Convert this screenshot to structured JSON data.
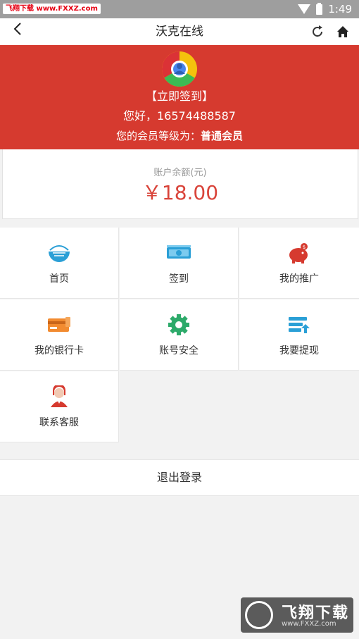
{
  "status_bar": {
    "watermark": "飞翔下载 www.FXXZ.com",
    "time": "1:49"
  },
  "nav": {
    "title": "沃克在线"
  },
  "profile": {
    "sign_in": "【立即签到】",
    "greeting": "您好，16574488587",
    "level_prefix": "您的会员等级为：",
    "level_value": "普通会员"
  },
  "balance": {
    "label": "账户余额(元)",
    "value": "￥18.00"
  },
  "menu": [
    {
      "label": "首页",
      "icon": "home-bowl-icon",
      "color": "#2a9fd6"
    },
    {
      "label": "签到",
      "icon": "cash-stack-icon",
      "color": "#2a9fd6"
    },
    {
      "label": "我的推广",
      "icon": "piggy-bank-icon",
      "color": "#d63a2f"
    },
    {
      "label": "我的银行卡",
      "icon": "bank-card-icon",
      "color": "#f28b30"
    },
    {
      "label": "账号安全",
      "icon": "gear-icon",
      "color": "#2daa6a"
    },
    {
      "label": "我要提现",
      "icon": "withdraw-icon",
      "color": "#2a9fd6"
    },
    {
      "label": "联系客服",
      "icon": "customer-service-icon",
      "color": "#d63a2f"
    }
  ],
  "logout": {
    "label": "退出登录"
  },
  "bottom_watermark": {
    "brand": "飞翔下载",
    "url": "www.FXXZ.com"
  },
  "colors": {
    "banner": "#d63a2f",
    "balance": "#d9443a"
  }
}
